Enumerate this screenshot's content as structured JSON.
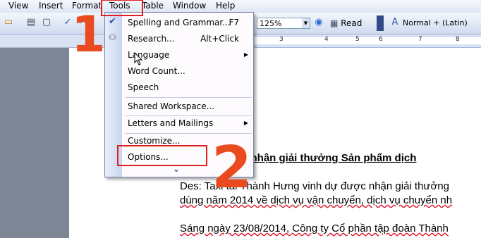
{
  "menubar": {
    "items": [
      "View",
      "Insert",
      "Format",
      "Tools",
      "Table",
      "Window",
      "Help"
    ]
  },
  "toolbar": {
    "zoom": "125%",
    "read_label": "Read",
    "style": "Normal + (Latin)"
  },
  "ruler": {
    "marks": [
      "3",
      "4",
      "5",
      "6",
      "7",
      "8"
    ]
  },
  "tools_menu": {
    "items": [
      {
        "label": "Spelling and Grammar...",
        "shortcut": "F7"
      },
      {
        "label": "Research...",
        "shortcut": "Alt+Click"
      },
      {
        "label": "Language"
      },
      {
        "label": "Word Count..."
      },
      {
        "label": "Speech"
      },
      {
        "label": "Shared Workspace..."
      },
      {
        "label": "Letters and Mailings"
      },
      {
        "label": "Customize..."
      },
      {
        "label": "Options..."
      }
    ],
    "expand_glyph": "⌄"
  },
  "document": {
    "title": "n Hưng nhận giải thưởng Sản phẩm dịch",
    "lines": [
      "Des: Taxi tải Thành Hưng vinh dự được nhận giải thưởng",
      "dùng năm 2014 về dịch vụ vận chuyển, dịch vụ chuyển nh",
      "Sáng ngày 23/08/2014, Công ty Cổ phần tập đoàn Thành"
    ]
  },
  "annotations": {
    "step1": "1",
    "step2": "2"
  },
  "colors": {
    "annotation": "#ea4a1f",
    "highlight_box": "#e02020",
    "menu_gutter": "#c7d5f0"
  }
}
